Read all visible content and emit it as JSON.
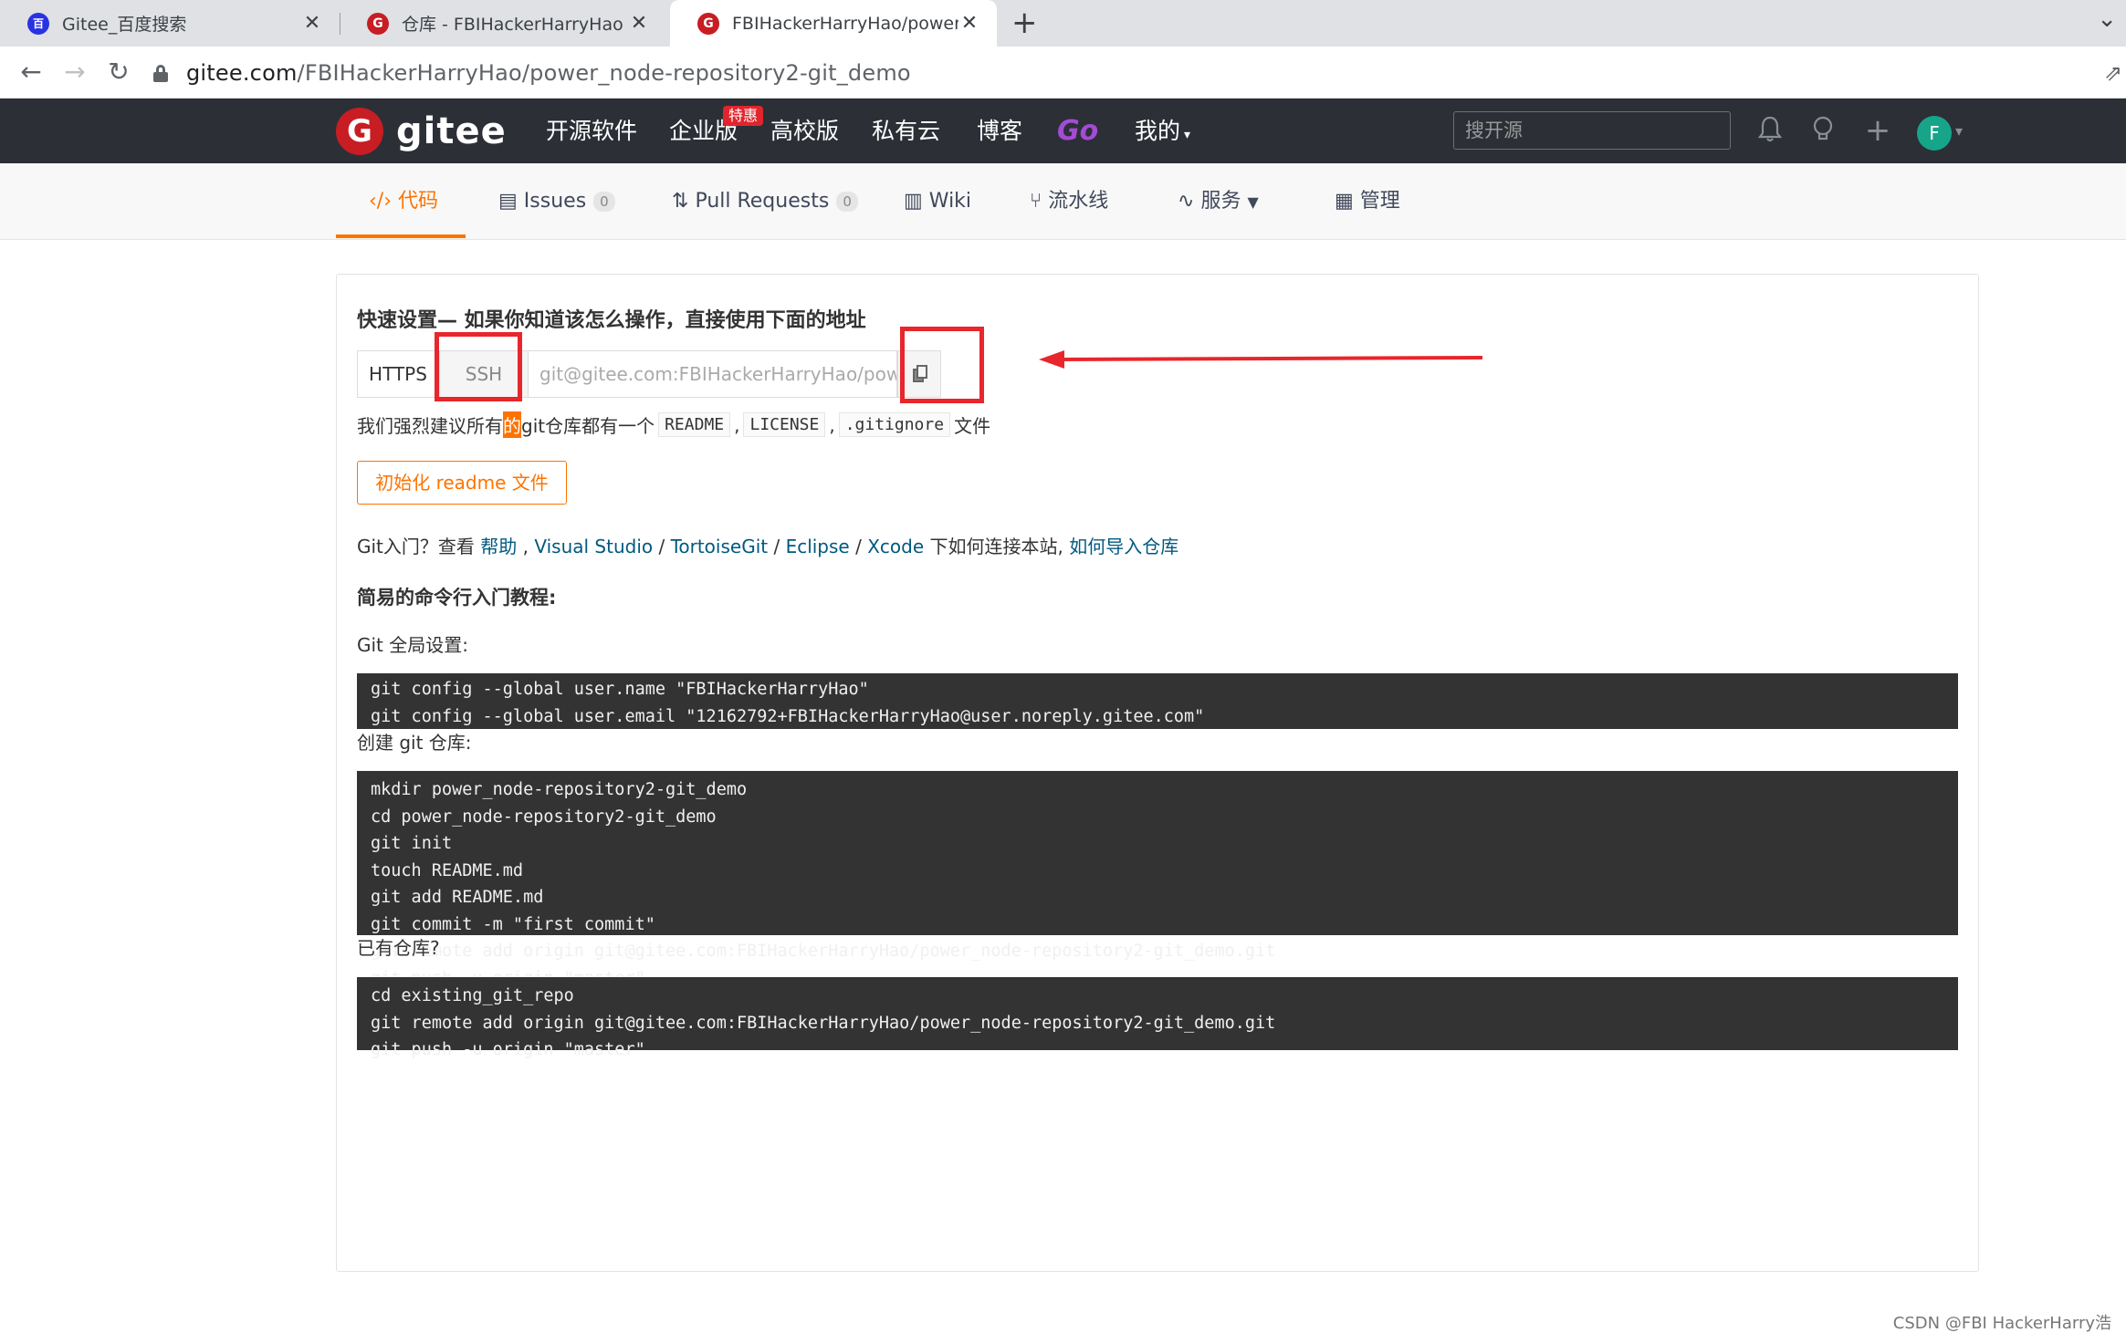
{
  "browser": {
    "tabs": [
      {
        "title": "Gitee_百度搜索",
        "favicon": "baidu-paw-icon"
      },
      {
        "title": "仓库 - FBIHackerHarryHao (FB",
        "favicon": "gitee-logo-icon"
      },
      {
        "title": "FBIHackerHarryHao/power_nc",
        "favicon": "gitee-logo-icon",
        "active": true
      }
    ],
    "url_host": "gitee.com",
    "url_path": "/FBIHackerHarryHao/power_node-repository2-git_demo"
  },
  "header": {
    "logo_text": "gitee",
    "nav": [
      "开源软件",
      "企业版",
      "高校版",
      "私有云",
      "博客",
      "Go",
      "我的"
    ],
    "enterprise_badge": "特惠",
    "search_placeholder": "搜开源",
    "avatar_letter": "F",
    "colors": {
      "bg": "#2c2f36",
      "brand": "#c71d23",
      "go": "#a44bd6"
    }
  },
  "repo_tabs": [
    {
      "label": "代码",
      "icon": "code-icon",
      "active": true
    },
    {
      "label": "Issues",
      "icon": "issues-icon",
      "count": "0"
    },
    {
      "label": "Pull Requests",
      "icon": "pull-request-icon",
      "count": "0"
    },
    {
      "label": "Wiki",
      "icon": "wiki-icon"
    },
    {
      "label": "流水线",
      "icon": "pipeline-icon"
    },
    {
      "label": "服务",
      "icon": "service-icon",
      "dropdown": true
    },
    {
      "label": "管理",
      "icon": "manage-icon"
    }
  ],
  "quick_setup": {
    "title": "快速设置— 如果你知道该怎么操作，直接使用下面的地址",
    "https_label": "HTTPS",
    "ssh_label": "SSH",
    "clone_url": "git@gitee.com:FBIHackerHarryHao/power_",
    "recommend_pre": "我们强烈建议所有",
    "recommend_hl": "的",
    "recommend_mid": "git仓库都有一个",
    "chip_readme": "README",
    "chip_license": "LICENSE",
    "chip_gitignore": ".gitignore",
    "recommend_post": "文件",
    "sep": ",",
    "init_button": "初始化 readme 文件",
    "intro_pre": "Git入门？查看 ",
    "intro_help": "帮助",
    "intro_vs": "Visual Studio",
    "intro_tortoise": "TortoiseGit",
    "intro_eclipse": "Eclipse",
    "intro_xcode": "Xcode",
    "intro_mid": " 下如何连接本站, ",
    "intro_import": "如何导入仓库",
    "accent": "#fe7300"
  },
  "tutorial": {
    "title": "简易的命令行入门教程:",
    "global_label": "Git 全局设置:",
    "global_code": "git config --global user.name \"FBIHackerHarryHao\"\ngit config --global user.email \"12162792+FBIHackerHarryHao@user.noreply.gitee.com\"",
    "create_label": "创建 git 仓库:",
    "create_code": "mkdir power_node-repository2-git_demo\ncd power_node-repository2-git_demo\ngit init\ntouch README.md\ngit add README.md\ngit commit -m \"first commit\"\ngit remote add origin git@gitee.com:FBIHackerHarryHao/power_node-repository2-git_demo.git\ngit push -u origin \"master\"",
    "existing_label": "已有仓库?",
    "existing_code": "cd existing_git_repo\ngit remote add origin git@gitee.com:FBIHackerHarryHao/power_node-repository2-git_demo.git\ngit push -u origin \"master\""
  },
  "watermark": "CSDN @FBI HackerHarry浩"
}
